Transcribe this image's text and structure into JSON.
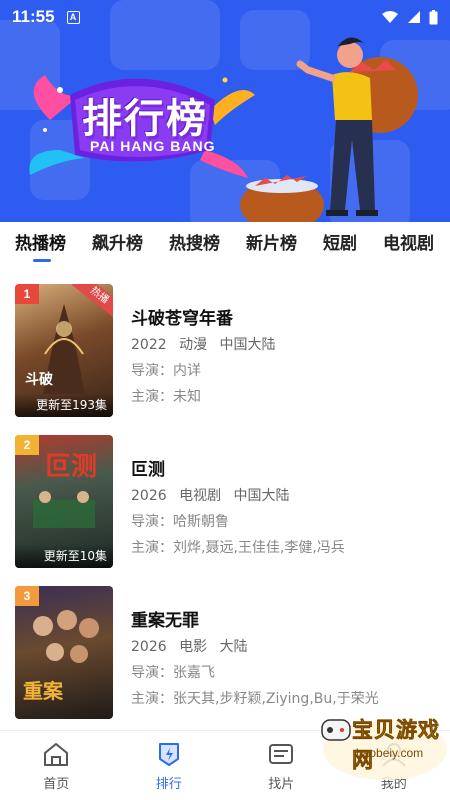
{
  "status_bar": {
    "time": "11:55",
    "notif_icon_letter": "A"
  },
  "banner": {
    "title": "排行榜",
    "subtitle": "PAI HANG BANG"
  },
  "tabs": [
    {
      "label": "热播榜",
      "active": true
    },
    {
      "label": "飙升榜",
      "active": false
    },
    {
      "label": "热搜榜",
      "active": false
    },
    {
      "label": "新片榜",
      "active": false
    },
    {
      "label": "短剧",
      "active": false
    },
    {
      "label": "电视剧",
      "active": false
    }
  ],
  "items": [
    {
      "rank": "1",
      "badge": "热播",
      "update": "更新至193集",
      "title": "斗破苍穹年番",
      "year": "2022",
      "genre": "动漫",
      "region": "中国大陆",
      "director": "导演：内详",
      "cast": "主演：未知",
      "rank_color": "#e8473b"
    },
    {
      "rank": "2",
      "badge": "",
      "update": "更新至10集",
      "title": "叵测",
      "year": "2026",
      "genre": "电视剧",
      "region": "中国大陆",
      "director": "导演：哈斯朝鲁",
      "cast": "主演：刘烨,聂远,王佳佳,李健,冯兵",
      "rank_color": "#f2b234"
    },
    {
      "rank": "3",
      "badge": "",
      "update": "",
      "title": "重案无罪",
      "year": "2026",
      "genre": "电影",
      "region": "大陆",
      "director": "导演：张嘉飞",
      "cast": "主演：张天其,步籽颖,Ziying,Bu,于荣光",
      "rank_color": "#f29a3c"
    }
  ],
  "nav": [
    {
      "label": "首页",
      "icon": "home-icon",
      "active": false
    },
    {
      "label": "排行",
      "icon": "ranking-icon",
      "active": true
    },
    {
      "label": "找片",
      "icon": "find-icon",
      "active": false
    },
    {
      "label": "我的",
      "icon": "profile-icon",
      "active": false
    }
  ],
  "watermark": {
    "text": "宝贝游戏网",
    "url": "baobeiy.com"
  },
  "colors": {
    "accent": "#2c6bf1",
    "banner_bg": "#2f5cf0"
  }
}
